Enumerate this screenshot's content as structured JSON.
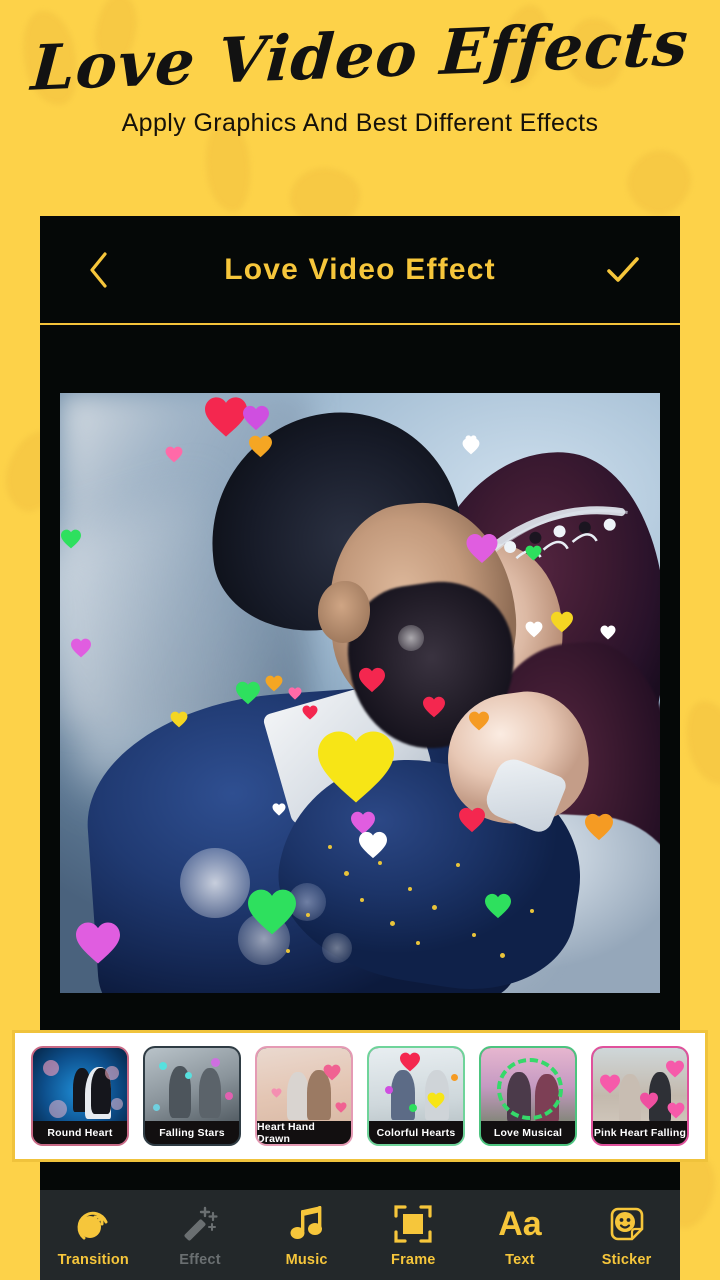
{
  "promo": {
    "title": "Love Video Effects",
    "subtitle": "Apply Graphics And Best Different Effects",
    "background_color": "#fdd249"
  },
  "appbar": {
    "back_icon": "chevron-left-icon",
    "title": "Love Video Effect",
    "done_icon": "check-icon",
    "accent_color": "#f6c63b",
    "background_color": "#050807"
  },
  "preview": {
    "description": "Couple photo preview with falling colorful hearts effect overlay"
  },
  "effects": {
    "selected": "Round Heart",
    "items": [
      {
        "label": "Round Heart",
        "border_color": "#c96a86"
      },
      {
        "label": "Falling Stars",
        "border_color": "#2f3c44"
      },
      {
        "label": "Heart Hand Drawn",
        "border_color": "#e59ab4"
      },
      {
        "label": "Colorful Hearts",
        "border_color": "#6fd49a"
      },
      {
        "label": "Love Musical",
        "border_color": "#4cc47f"
      },
      {
        "label": "Pink Heart Falling",
        "border_color": "#e0519c"
      }
    ]
  },
  "toolbar": {
    "items": [
      {
        "label": "Transition",
        "icon": "transition-icon",
        "enabled": true
      },
      {
        "label": "Effect",
        "icon": "magic-wand-icon",
        "enabled": false
      },
      {
        "label": "Music",
        "icon": "music-note-icon",
        "enabled": true
      },
      {
        "label": "Frame",
        "icon": "frame-icon",
        "enabled": true
      },
      {
        "label": "Text",
        "icon": "text-aa-icon",
        "enabled": true
      },
      {
        "label": "Sticker",
        "icon": "sticker-smiley-icon",
        "enabled": true
      }
    ]
  }
}
